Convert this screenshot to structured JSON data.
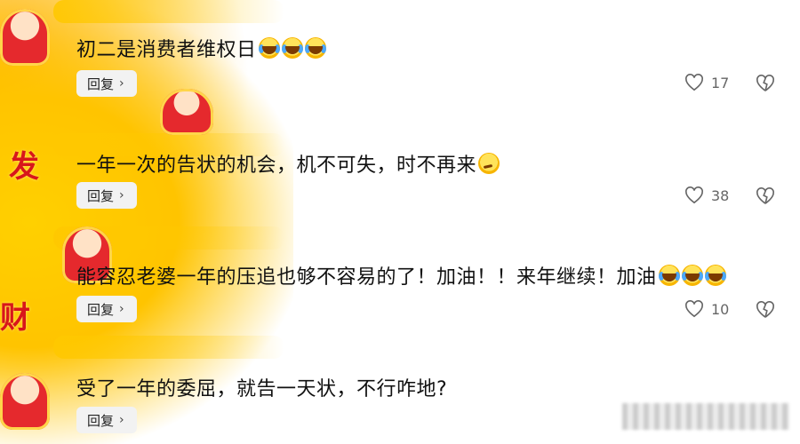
{
  "comments": [
    {
      "text": "初二是消费者维权日",
      "emojis": [
        "laugh",
        "laugh",
        "laugh"
      ],
      "reply_label": "回复",
      "likes": "17"
    },
    {
      "text": "一年一次的告状的机会，机不可失，时不再来",
      "emojis": [
        "smirk"
      ],
      "reply_label": "回复",
      "likes": "38"
    },
    {
      "text": "能容忍老婆一年的压追也够不容易的了！加油！！来年继续！加油",
      "emojis": [
        "laugh",
        "laugh",
        "laugh"
      ],
      "reply_label": "回复",
      "likes": "10"
    },
    {
      "text": "受了一年的委屈，就告一天状，不行咋地?",
      "emojis": [],
      "reply_label": "回复",
      "likes": ""
    }
  ],
  "decor": {
    "char_1": "发",
    "char_2": "财"
  },
  "colors": {
    "accent_yellow": "#ffc400",
    "text": "#111111",
    "icon_gray": "#666666"
  }
}
